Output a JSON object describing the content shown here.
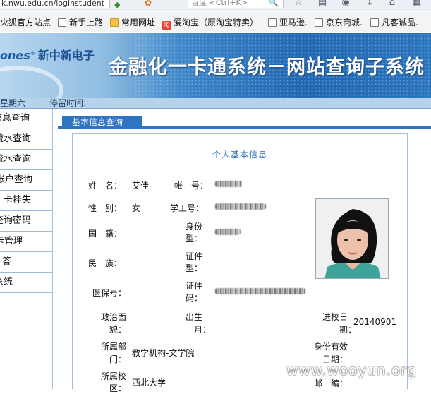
{
  "browser": {
    "url": "k.nwu.edu.cn/loginstudent",
    "search_placeholder": "百度 <Ctrl+K>",
    "bookmarks": [
      {
        "label": "火狐官方站点",
        "icon": "none"
      },
      {
        "label": "新手上路",
        "icon": "page"
      },
      {
        "label": "常用网址",
        "icon": "folder"
      },
      {
        "label": "爱淘宝（原淘宝特卖）",
        "icon": "taobao"
      },
      {
        "label": "亚马逊.",
        "icon": "page"
      },
      {
        "label": "京东商城.",
        "icon": "page"
      },
      {
        "label": "凡客诚品.",
        "icon": "page"
      }
    ]
  },
  "header": {
    "logo_en": "ones",
    "logo_cn": "新中新电子",
    "system_title": "金融化一卡通系统－网站查询子系统"
  },
  "status_bar": {
    "weekday": "星期六",
    "stay_time_label": "停留时间:"
  },
  "sidebar": {
    "items": [
      {
        "label": "信息查询"
      },
      {
        "label": "流水查询"
      },
      {
        "label": "流水查询"
      },
      {
        "label": "账户查询"
      },
      {
        "label": "卡挂失"
      },
      {
        "label": "查询密码"
      },
      {
        "label": "卡管理"
      },
      {
        "label": "答"
      },
      {
        "label": "系统"
      }
    ]
  },
  "main": {
    "tab_label": "基本信息查询",
    "panel_title": "个人基本信息",
    "fields": {
      "name_label": "姓　名：",
      "name_value": "艾佳",
      "account_label": "帐　号：",
      "gender_label": "性　别：",
      "gender_value": "女",
      "student_id_label": "学工号：",
      "nationality_label": "国　籍：",
      "id_type_label_1": "身份",
      "id_type_label_2": "型：",
      "ethnicity_label": "民　族：",
      "id_number_label_1": "证件",
      "id_number_label_2": "型：",
      "medical_label": "医保号：",
      "cert_label_1": "证件",
      "cert_label_2": "码：",
      "political_label_1": "政治面",
      "political_label_2": "貌：",
      "birth_label_1": "出生",
      "birth_label_2": "月：",
      "enroll_label_1": "进校日",
      "enroll_label_2": "期：",
      "enroll_value": "20140901",
      "dept_label_1": "所属部",
      "dept_label_2": "门：",
      "dept_value": "教学机构-文学院",
      "validity_label_1": "身份有效",
      "validity_label_2": "日期：",
      "campus_label_1": "所属校",
      "campus_label_2": "区：",
      "campus_value": "西北大学",
      "mail_label": "邮　编："
    }
  },
  "watermark": "www.wooyun.org"
}
